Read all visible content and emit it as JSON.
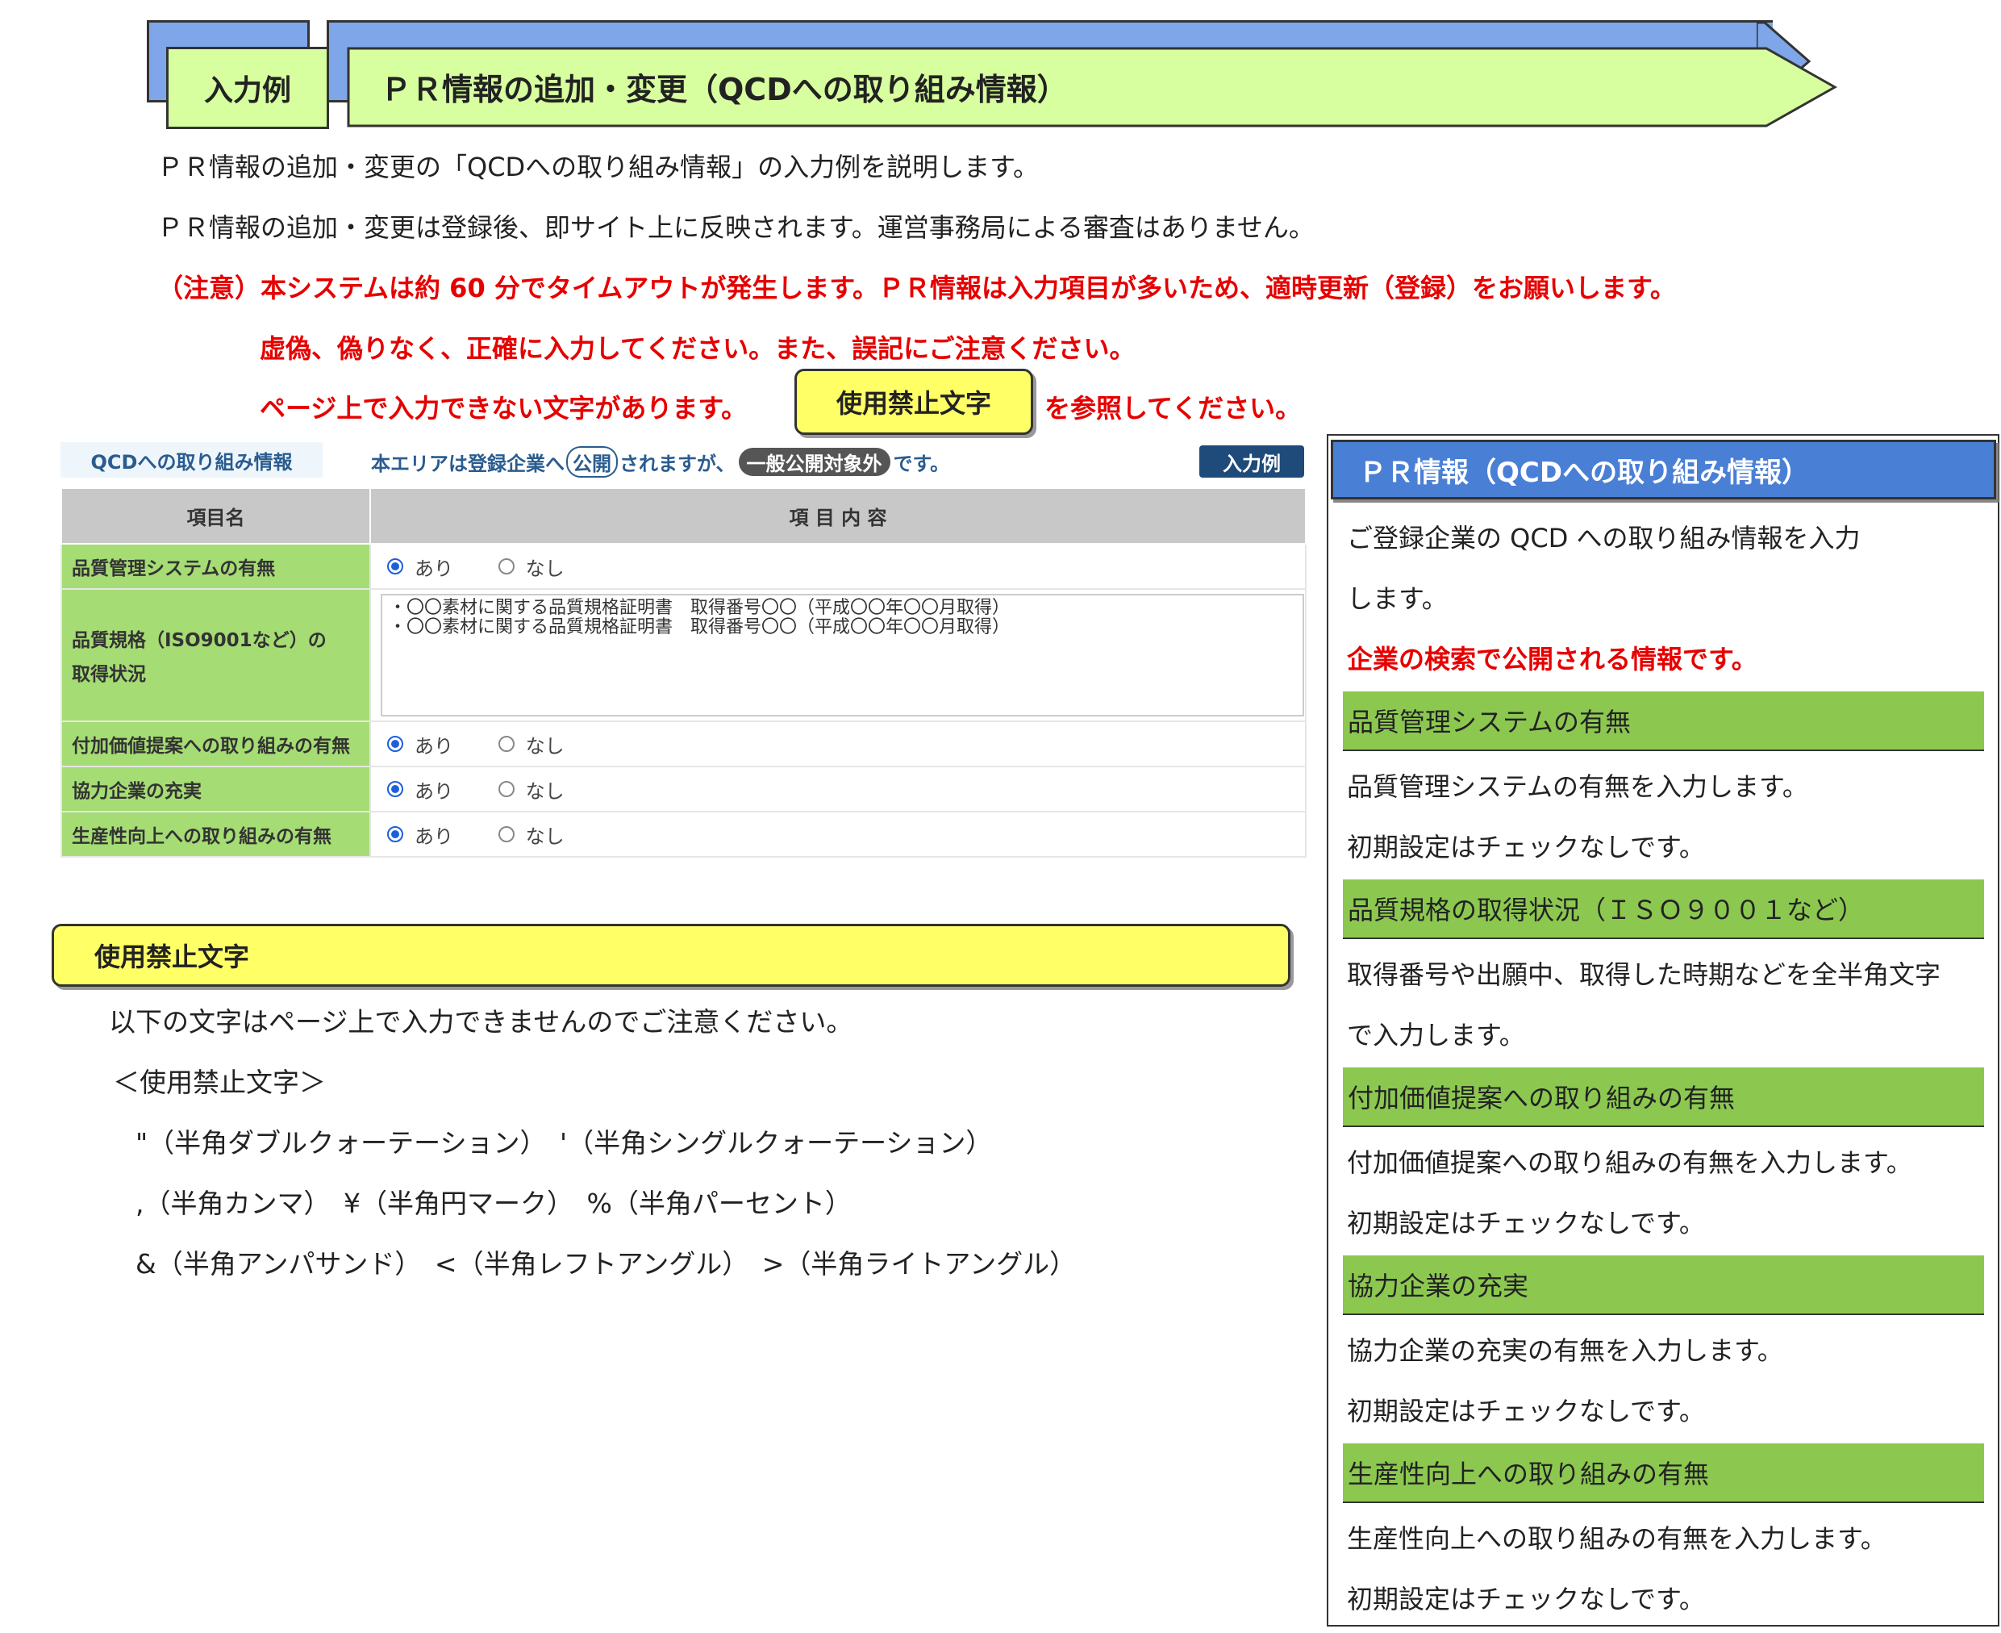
{
  "banner": {
    "tag": "入力例",
    "title": "ＰＲ情報の追加・変更（QCDへの取り組み情報）"
  },
  "intro": {
    "line1": "ＰＲ情報の追加・変更の「QCDへの取り組み情報」の入力例を説明します。",
    "line2": "ＰＲ情報の追加・変更は登録後、即サイト上に反映されます。運営事務局による審査はありません。",
    "warn1": "（注意）本システムは約 60 分でタイムアウトが発生します。ＰＲ情報は入力項目が多いため、適時更新（登録）をお願いします。",
    "warn2": "虚偽、偽りなく、正確に入力してください。また、誤記にご注意ください。",
    "warn3a": "ページ上で入力できない文字があります。",
    "warn3_button": "使用禁止文字",
    "warn3b": "を参照してください。"
  },
  "form": {
    "section_label": "QCDへの取り組み情報",
    "note_pre": "本エリアは登録企業へ",
    "note_public": "公開",
    "note_mid": "されますが、",
    "note_excluded": "一般公開対象外",
    "note_post": "です。",
    "example_button": "入力例",
    "col_item": "項目名",
    "col_content": "項 目 内 容",
    "opt_yes": "あり",
    "opt_no": "なし",
    "rows": [
      {
        "label": "品質管理システムの有無",
        "selected": "yes"
      },
      {
        "label": "付加価値提案への取り組みの有無",
        "selected": "yes"
      },
      {
        "label": "協力企業の充実",
        "selected": "yes"
      },
      {
        "label": "生産性向上への取り組みの有無",
        "selected": "yes"
      }
    ],
    "iso_label_1": "品質規格（ISO9001など）の",
    "iso_label_2": "取得状況",
    "iso_value_1": "・〇〇素材に関する品質規格証明書　取得番号〇〇（平成〇〇年〇〇月取得）",
    "iso_value_2": "・〇〇素材に関する品質規格証明書　取得番号〇〇（平成〇〇年〇〇月取得）"
  },
  "forbidden": {
    "title": "使用禁止文字",
    "desc": "以下の文字はページ上で入力できませんのでご注意ください。",
    "heading": "＜使用禁止文字＞",
    "line1": "\"（半角ダブルクォーテーション）　'（半角シングルクォーテーション）",
    "line2": ",（半角カンマ）　¥（半角円マーク）　%（半角パーセント）",
    "line3": "&（半角アンパサンド）　<（半角レフトアングル）　>（半角ライトアングル）"
  },
  "panel": {
    "title": "ＰＲ情報（QCDへの取り組み情報）",
    "intro1": "ご登録企業の QCD への取り組み情報を入力",
    "intro2": "します。",
    "red": "企業の検索で公開される情報です。",
    "sections": [
      {
        "head": "品質管理システムの有無",
        "l1": "品質管理システムの有無を入力します。",
        "l2": "初期設定はチェックなしです。"
      },
      {
        "head": "品質規格の取得状況（ＩＳＯ９００１など）",
        "l1": "取得番号や出願中、取得した時期などを全半角文字",
        "l2": "で入力します。"
      },
      {
        "head": "付加価値提案への取り組みの有無",
        "l1": "付加価値提案への取り組みの有無を入力します。",
        "l2": "初期設定はチェックなしです。"
      },
      {
        "head": "協力企業の充実",
        "l1": "協力企業の充実の有無を入力します。",
        "l2": "初期設定はチェックなしです。"
      },
      {
        "head": "生産性向上への取り組みの有無",
        "l1": "生産性向上への取り組みの有無を入力します。",
        "l2": "初期設定はチェックなしです。"
      }
    ]
  },
  "colors": {
    "banner_blue": "#7ea6e8",
    "banner_green": "#d7ff9f",
    "label_green": "#a6dc74",
    "panel_green": "#8cc850",
    "warn_red": "#e60000",
    "note_blue": "#2a5c8f",
    "highlight_yellow": "#ffff66"
  }
}
